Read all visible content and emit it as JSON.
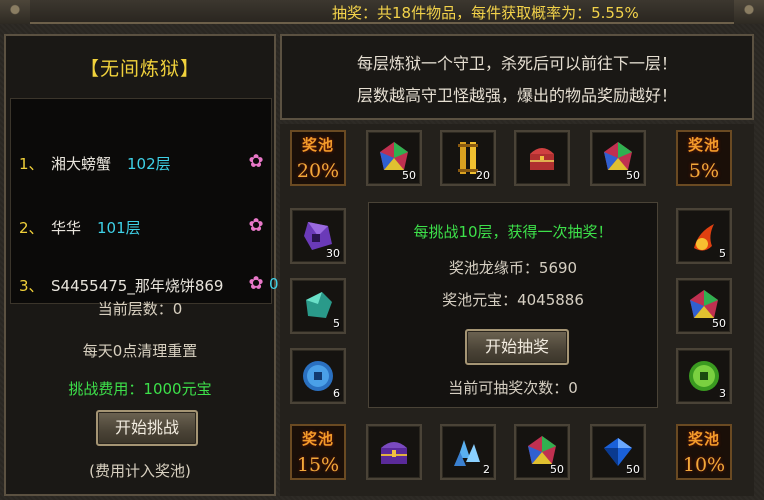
{
  "top": {
    "notice": "抽奖：共18件物品，每件获取概率为：5.55%"
  },
  "left": {
    "heading": "【无间炼狱】",
    "ranking": [
      {
        "no": "1、",
        "name": "湘大螃蟹",
        "floor": "102层"
      },
      {
        "no": "2、",
        "name": "华华",
        "floor": "101层"
      },
      {
        "no": "3、",
        "name": "S4455475_那年烧饼869",
        "floor": "0"
      }
    ],
    "current_floor": "当前层数：0",
    "daily_reset": "每天0点清理重置",
    "fee": "挑战费用：1000元宝",
    "start_button": "开始挑战",
    "fee_note": "(费用计入奖池)"
  },
  "header": {
    "line1": "每层炼狱一个守卫，杀死后可以前往下一层！",
    "line2": "层数越高守卫怪越强，爆出的物品奖励越好！"
  },
  "pools": {
    "label": "奖池",
    "top_left": "20%",
    "top_right": "5%",
    "bottom_left": "15%",
    "bottom_right": "10%"
  },
  "items": {
    "t1": {
      "icon": "rainbow-gem-icon",
      "count": "50"
    },
    "t2": {
      "icon": "gold-scroll-icon",
      "count": "20"
    },
    "t3": {
      "icon": "treasure-chest-icon",
      "count": ""
    },
    "t4": {
      "icon": "rainbow-gem-icon",
      "count": "50"
    },
    "l1": {
      "icon": "purple-crystal-icon",
      "count": "30"
    },
    "l2": {
      "icon": "jade-stone-icon",
      "count": "5"
    },
    "l3": {
      "icon": "blue-coin-icon",
      "count": "6"
    },
    "r1": {
      "icon": "fireball-icon",
      "count": "5"
    },
    "r2": {
      "icon": "rainbow-gem-icon",
      "count": "50"
    },
    "r3": {
      "icon": "green-coin-icon",
      "count": "3"
    },
    "b1": {
      "icon": "purple-chest-icon",
      "count": ""
    },
    "b2": {
      "icon": "ice-crystal-icon",
      "count": "2"
    },
    "b3": {
      "icon": "rainbow-gem-icon",
      "count": "50"
    },
    "b4": {
      "icon": "blue-diamond-icon",
      "count": "50"
    }
  },
  "center": {
    "headline": "每挑战10层，获得一次抽奖！",
    "dragon_coin": "奖池龙缘币：5690",
    "yuanbao": "奖池元宝：4045886",
    "draw_button": "开始抽奖",
    "draws_left": "当前可抽奖次数：0"
  },
  "colors": {
    "accent_yellow": "#f1d23c",
    "green": "#3de04a",
    "cyan": "#3fd2e8",
    "pool_orange": "#f29a2a"
  }
}
